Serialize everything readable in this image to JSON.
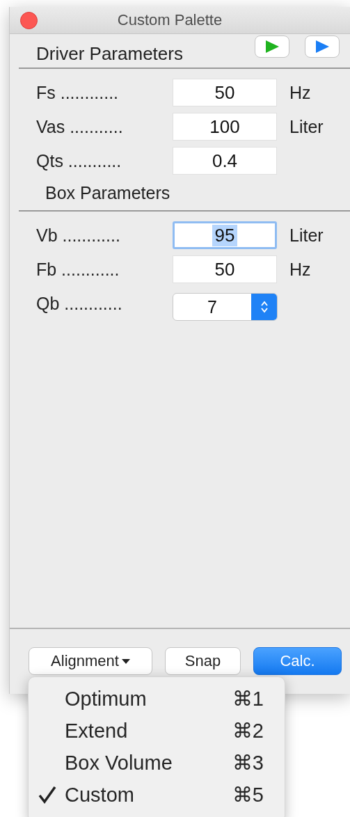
{
  "window": {
    "title": "Custom Palette"
  },
  "driver_parameters": {
    "title": "Driver Parameters",
    "play_buttons": [
      {
        "color": "#1fb31f"
      },
      {
        "color": "#1a7ef5"
      }
    ],
    "fields": [
      {
        "label": "Fs ............",
        "kind": "text",
        "value": "50",
        "unit": "Hz",
        "focused": false
      },
      {
        "label": "Vas ...........",
        "kind": "text",
        "value": "100",
        "unit": "Liter",
        "focused": false
      },
      {
        "label": "Qts ...........",
        "kind": "text",
        "value": "0.4",
        "focused": false
      }
    ]
  },
  "box_parameters": {
    "title": "Box Parameters",
    "fields": [
      {
        "label": "Vb ............",
        "kind": "text",
        "value": "95",
        "unit": "Liter",
        "focused": true
      },
      {
        "label": "Fb ............",
        "kind": "text",
        "value": "50",
        "unit": "Hz",
        "focused": false
      },
      {
        "label": "Qb ............",
        "kind": "popup",
        "value": "7"
      }
    ]
  },
  "footer_buttons": [
    {
      "label": "Alignment",
      "kind": "menu",
      "expanded": true
    },
    {
      "label": "Snap",
      "kind": "plain"
    },
    {
      "label": "Calc.",
      "kind": "default"
    }
  ],
  "alignment_menu": [
    {
      "label": "Optimum",
      "shortcut": "⌘1",
      "checked": false
    },
    {
      "label": "Extend",
      "shortcut": "⌘2",
      "checked": false
    },
    {
      "label": "Box Volume",
      "shortcut": "⌘3",
      "checked": false
    },
    {
      "label": "Custom",
      "shortcut": "⌘5",
      "checked": true
    }
  ]
}
